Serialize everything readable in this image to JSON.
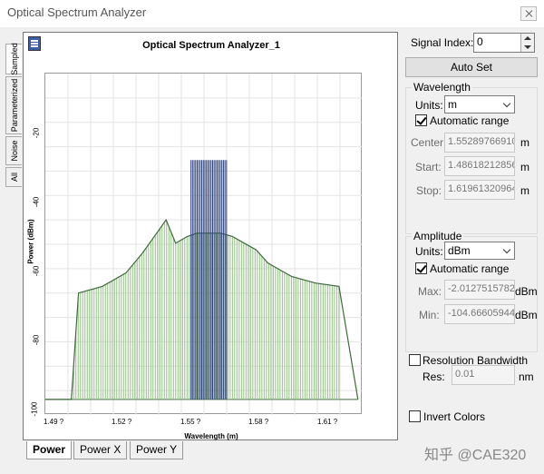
{
  "window": {
    "title": "Optical Spectrum Analyzer"
  },
  "side_tabs": [
    "Sampled",
    "Parameterized",
    "Noise",
    "All"
  ],
  "plot": {
    "title": "Optical Spectrum Analyzer_1",
    "colors": {
      "signal": "#3d6b3a",
      "signal_fill": "#8fc27f",
      "peaks": "#2a3f7a"
    }
  },
  "chart_data": {
    "type": "line",
    "xlabel": "Wavelength (m)",
    "ylabel": "Power (dBm)",
    "x_ticks": [
      "1.49 ?",
      "1.52 ?",
      "1.55 ?",
      "1.58 ?",
      "1.61 ?"
    ],
    "y_ticks": [
      "-20",
      "-40",
      "-60",
      "-80",
      "-100"
    ],
    "xlim": [
      1.486,
      1.62
    ],
    "ylim": [
      -104.67,
      -2.01
    ],
    "series": [
      {
        "x": [
          1.486,
          1.497,
          1.5,
          1.51,
          1.52,
          1.527,
          1.533,
          1.537,
          1.541,
          1.546,
          1.55,
          1.555,
          1.56,
          1.565,
          1.57,
          1.575,
          1.58,
          1.585,
          1.59,
          1.6,
          1.61,
          1.618
        ],
        "y": [
          -100,
          -100,
          -68,
          -66,
          -62,
          -56,
          -50,
          -46,
          -53,
          -51,
          -50,
          -50,
          -50,
          -51,
          -53,
          -55,
          -59,
          -61,
          -63,
          -65,
          -66,
          -100
        ]
      },
      {
        "x_start": 1.5475,
        "x_end": 1.5625,
        "count": 24,
        "y": -28
      }
    ]
  },
  "bottom_tabs": [
    "Power",
    "Power X",
    "Power Y"
  ],
  "signal_index": {
    "label": "Signal Index:",
    "value": "0"
  },
  "auto_set": "Auto Set",
  "wavelength": {
    "title": "Wavelength",
    "units_label": "Units:",
    "units": "m",
    "auto_range": "Automatic range",
    "center_label": "Center:",
    "center": "1.55289766910",
    "start_label": "Start:",
    "start": "1.48618212856",
    "stop_label": "Stop:",
    "stop": "1.61961320964",
    "unit": "m"
  },
  "amplitude": {
    "title": "Amplitude",
    "units_label": "Units:",
    "units": "dBm",
    "auto_range": "Automatic range",
    "max_label": "Max:",
    "max": "-2.0127515782",
    "min_label": "Min:",
    "min": "-104.66605944",
    "unit": "dBm"
  },
  "resolution": {
    "label": "Resolution Bandwidth",
    "res_label": "Res:",
    "res": "0.01",
    "unit": "nm"
  },
  "invert_colors": "Invert Colors",
  "watermark": "知乎 @CAE320"
}
